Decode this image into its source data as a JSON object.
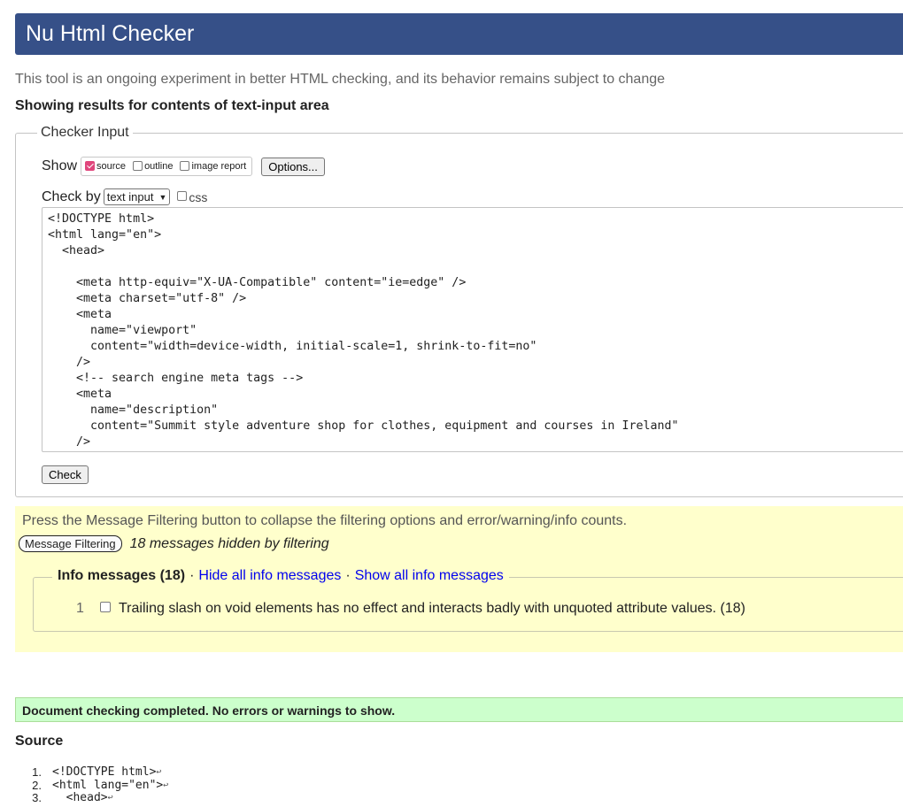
{
  "header": {
    "title": "Nu Html Checker"
  },
  "subtitle": "This tool is an ongoing experiment in better HTML checking, and its behavior remains subject to change",
  "results_for": "Showing results for contents of text-input area",
  "checker_input": {
    "legend": "Checker Input",
    "show_label": "Show",
    "show_options": [
      {
        "label": "source",
        "checked": true
      },
      {
        "label": "outline",
        "checked": false
      },
      {
        "label": "image report",
        "checked": false
      }
    ],
    "options_button": "Options...",
    "check_by_label": "Check by",
    "check_by_value": "text input",
    "css_label": "css",
    "code": "<!DOCTYPE html>\n<html lang=\"en\">\n  <head>\n\n    <meta http-equiv=\"X-UA-Compatible\" content=\"ie=edge\" />\n    <meta charset=\"utf-8\" />\n    <meta\n      name=\"viewport\"\n      content=\"width=device-width, initial-scale=1, shrink-to-fit=no\"\n    />\n    <!-- search engine meta tags -->\n    <meta\n      name=\"description\"\n      content=\"Summit style adventure shop for clothes, equipment and courses in Ireland\"\n    />",
    "check_button": "Check"
  },
  "filtering": {
    "note": "Press the Message Filtering button to collapse the filtering options and error/warning/info counts.",
    "button": "Message Filtering",
    "hidden_count": "18 messages hidden by filtering",
    "info_legend": "Info messages (18)",
    "separator": "·",
    "hide_link": "Hide all info messages",
    "show_link": "Show all info messages",
    "items": [
      {
        "num": "1",
        "text": "Trailing slash on void elements has no effect and interacts badly with unquoted attribute values. (18)"
      }
    ]
  },
  "success_message": "Document checking completed. No errors or warnings to show.",
  "source": {
    "heading": "Source",
    "lines": [
      {
        "num": "1.",
        "text": "<!DOCTYPE html>"
      },
      {
        "num": "2.",
        "text": "<html lang=\"en\">"
      },
      {
        "num": "3.",
        "text": "  <head>"
      }
    ],
    "return_glyph": "↩"
  }
}
